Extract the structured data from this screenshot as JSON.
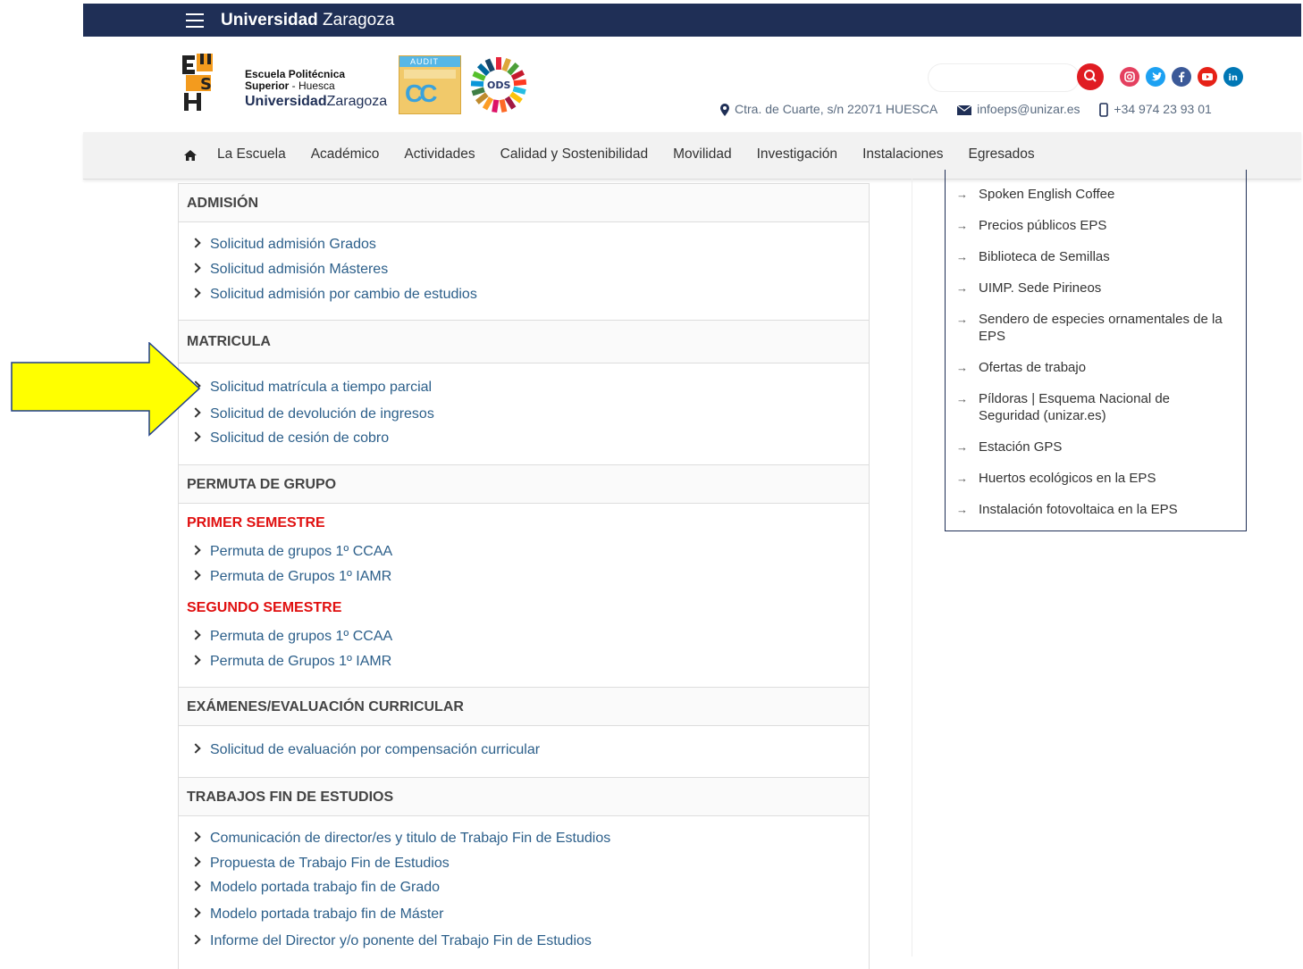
{
  "topbar": {
    "brand_bold": "Universidad",
    "brand_rest": " Zaragoza"
  },
  "header": {
    "school_line1": "Escuela Politécnica",
    "school_line2a": "Superior",
    "school_line2b": " - Huesca",
    "uni_bold": "Universidad",
    "uni_rest": "Zaragoza",
    "audit_label": "AUDIT",
    "ods_label": "ODS",
    "search_placeholder": "",
    "address": "Ctra. de Cuarte, s/n 22071 HUESCA",
    "email": "infoeps@unizar.es",
    "phone": "+34 974 23 93 01"
  },
  "social": {
    "instagram_color": "#e4405f",
    "twitter_color": "#1da1f2",
    "facebook_color": "#3b5998",
    "youtube_color": "#ff0000",
    "linkedin_color": "#0077b5"
  },
  "nav": {
    "items": [
      "La Escuela",
      "Académico",
      "Actividades",
      "Calidad y Sostenibilidad",
      "Movilidad",
      "Investigación",
      "Instalaciones",
      "Egresados"
    ]
  },
  "sections": {
    "admision": {
      "title": "ADMISIÓN",
      "links": [
        "Solicitud admisión Grados",
        "Solicitud admisión Másteres",
        "Solicitud admisión por cambio de estudios"
      ]
    },
    "matricula": {
      "title": "MATRICULA",
      "links": [
        "Solicitud matrícula a tiempo parcial",
        "Solicitud de devolución de ingresos",
        "Solicitud de cesión de cobro"
      ]
    },
    "permuta": {
      "title": "PERMUTA DE GRUPO",
      "primer": "PRIMER SEMESTRE",
      "primer_links": [
        "Permuta de grupos 1º CCAA",
        "Permuta de Grupos 1º IAMR"
      ],
      "segundo": "SEGUNDO SEMESTRE",
      "segundo_links": [
        "Permuta de grupos 1º CCAA",
        "Permuta de Grupos 1º IAMR"
      ]
    },
    "examenes": {
      "title": "EXÁMENES/EVALUACIÓN CURRICULAR",
      "links": [
        "Solicitud de evaluación por compensación curricular"
      ]
    },
    "tfe": {
      "title": "TRABAJOS FIN DE ESTUDIOS",
      "links": [
        "Comunicación de director/es y titulo de Trabajo Fin de Estudios",
        "Propuesta de Trabajo Fin de Estudios",
        "Modelo portada trabajo fin de Grado",
        "Modelo portada trabajo fin de Máster",
        "Informe del Director y/o ponente del Trabajo Fin de Estudios"
      ]
    }
  },
  "sidebar": {
    "items": [
      "Spoken English Coffee",
      "Precios públicos EPS",
      "Biblioteca de Semillas",
      "UIMP. Sede Pirineos",
      "Sendero de especies ornamentales de la EPS",
      "Ofertas de trabajo",
      "Píldoras | Esquema Nacional de Seguridad (unizar.es)",
      "Estación GPS",
      "Huertos ecológicos en la EPS",
      "Instalación fotovoltaica en la EPS"
    ]
  },
  "colors": {
    "brand_navy": "#1f2f56",
    "link": "#2c5f8a",
    "accent_red": "#e01c22",
    "highlight_arrow": "#ffff00"
  }
}
